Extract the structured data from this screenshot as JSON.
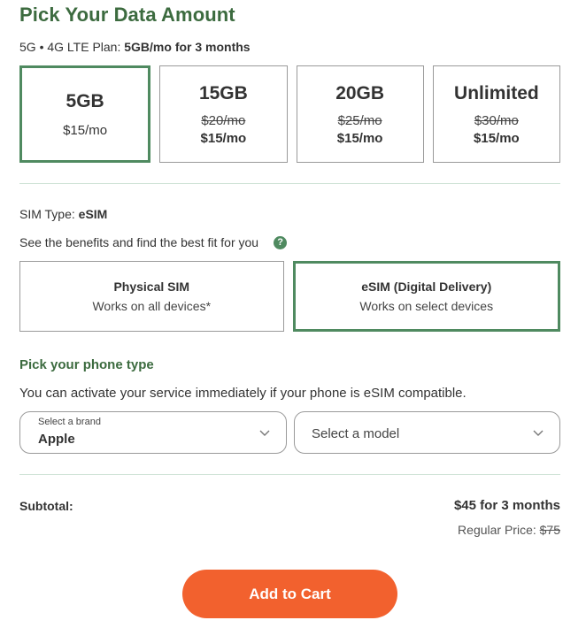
{
  "title": "Pick Your Data Amount",
  "plan_summary": {
    "prefix": "5G • 4G LTE Plan:",
    "selected": "5GB/mo for 3 months"
  },
  "plans": [
    {
      "name": "5GB",
      "old_price": "",
      "price": "$15/mo",
      "selected": true
    },
    {
      "name": "15GB",
      "old_price": "$20/mo",
      "price": "$15/mo",
      "selected": false
    },
    {
      "name": "20GB",
      "old_price": "$25/mo",
      "price": "$15/mo",
      "selected": false
    },
    {
      "name": "Unlimited",
      "old_price": "$30/mo",
      "price": "$15/mo",
      "selected": false
    }
  ],
  "sim": {
    "type_label": "SIM Type:",
    "type_value": "eSIM",
    "benefits_text": "See the benefits and find the best fit for you",
    "help_icon": "?",
    "options": [
      {
        "name": "Physical SIM",
        "desc": "Works on all devices*",
        "selected": false
      },
      {
        "name": "eSIM (Digital Delivery)",
        "desc": "Works on select devices",
        "selected": true
      }
    ]
  },
  "phone": {
    "title": "Pick your phone type",
    "desc": "You can activate your service immediately if your phone is eSIM compatible.",
    "brand_label": "Select a brand",
    "brand_value": "Apple",
    "model_placeholder": "Select a model"
  },
  "summary": {
    "subtotal_label": "Subtotal:",
    "subtotal_value": "$45 for 3 months",
    "regular_label": "Regular Price:",
    "regular_value": "$75"
  },
  "cart_button": "Add to Cart",
  "colors": {
    "brand_green": "#3c6b3f",
    "selected_border": "#4f8a60",
    "cta_orange": "#f2612e"
  }
}
